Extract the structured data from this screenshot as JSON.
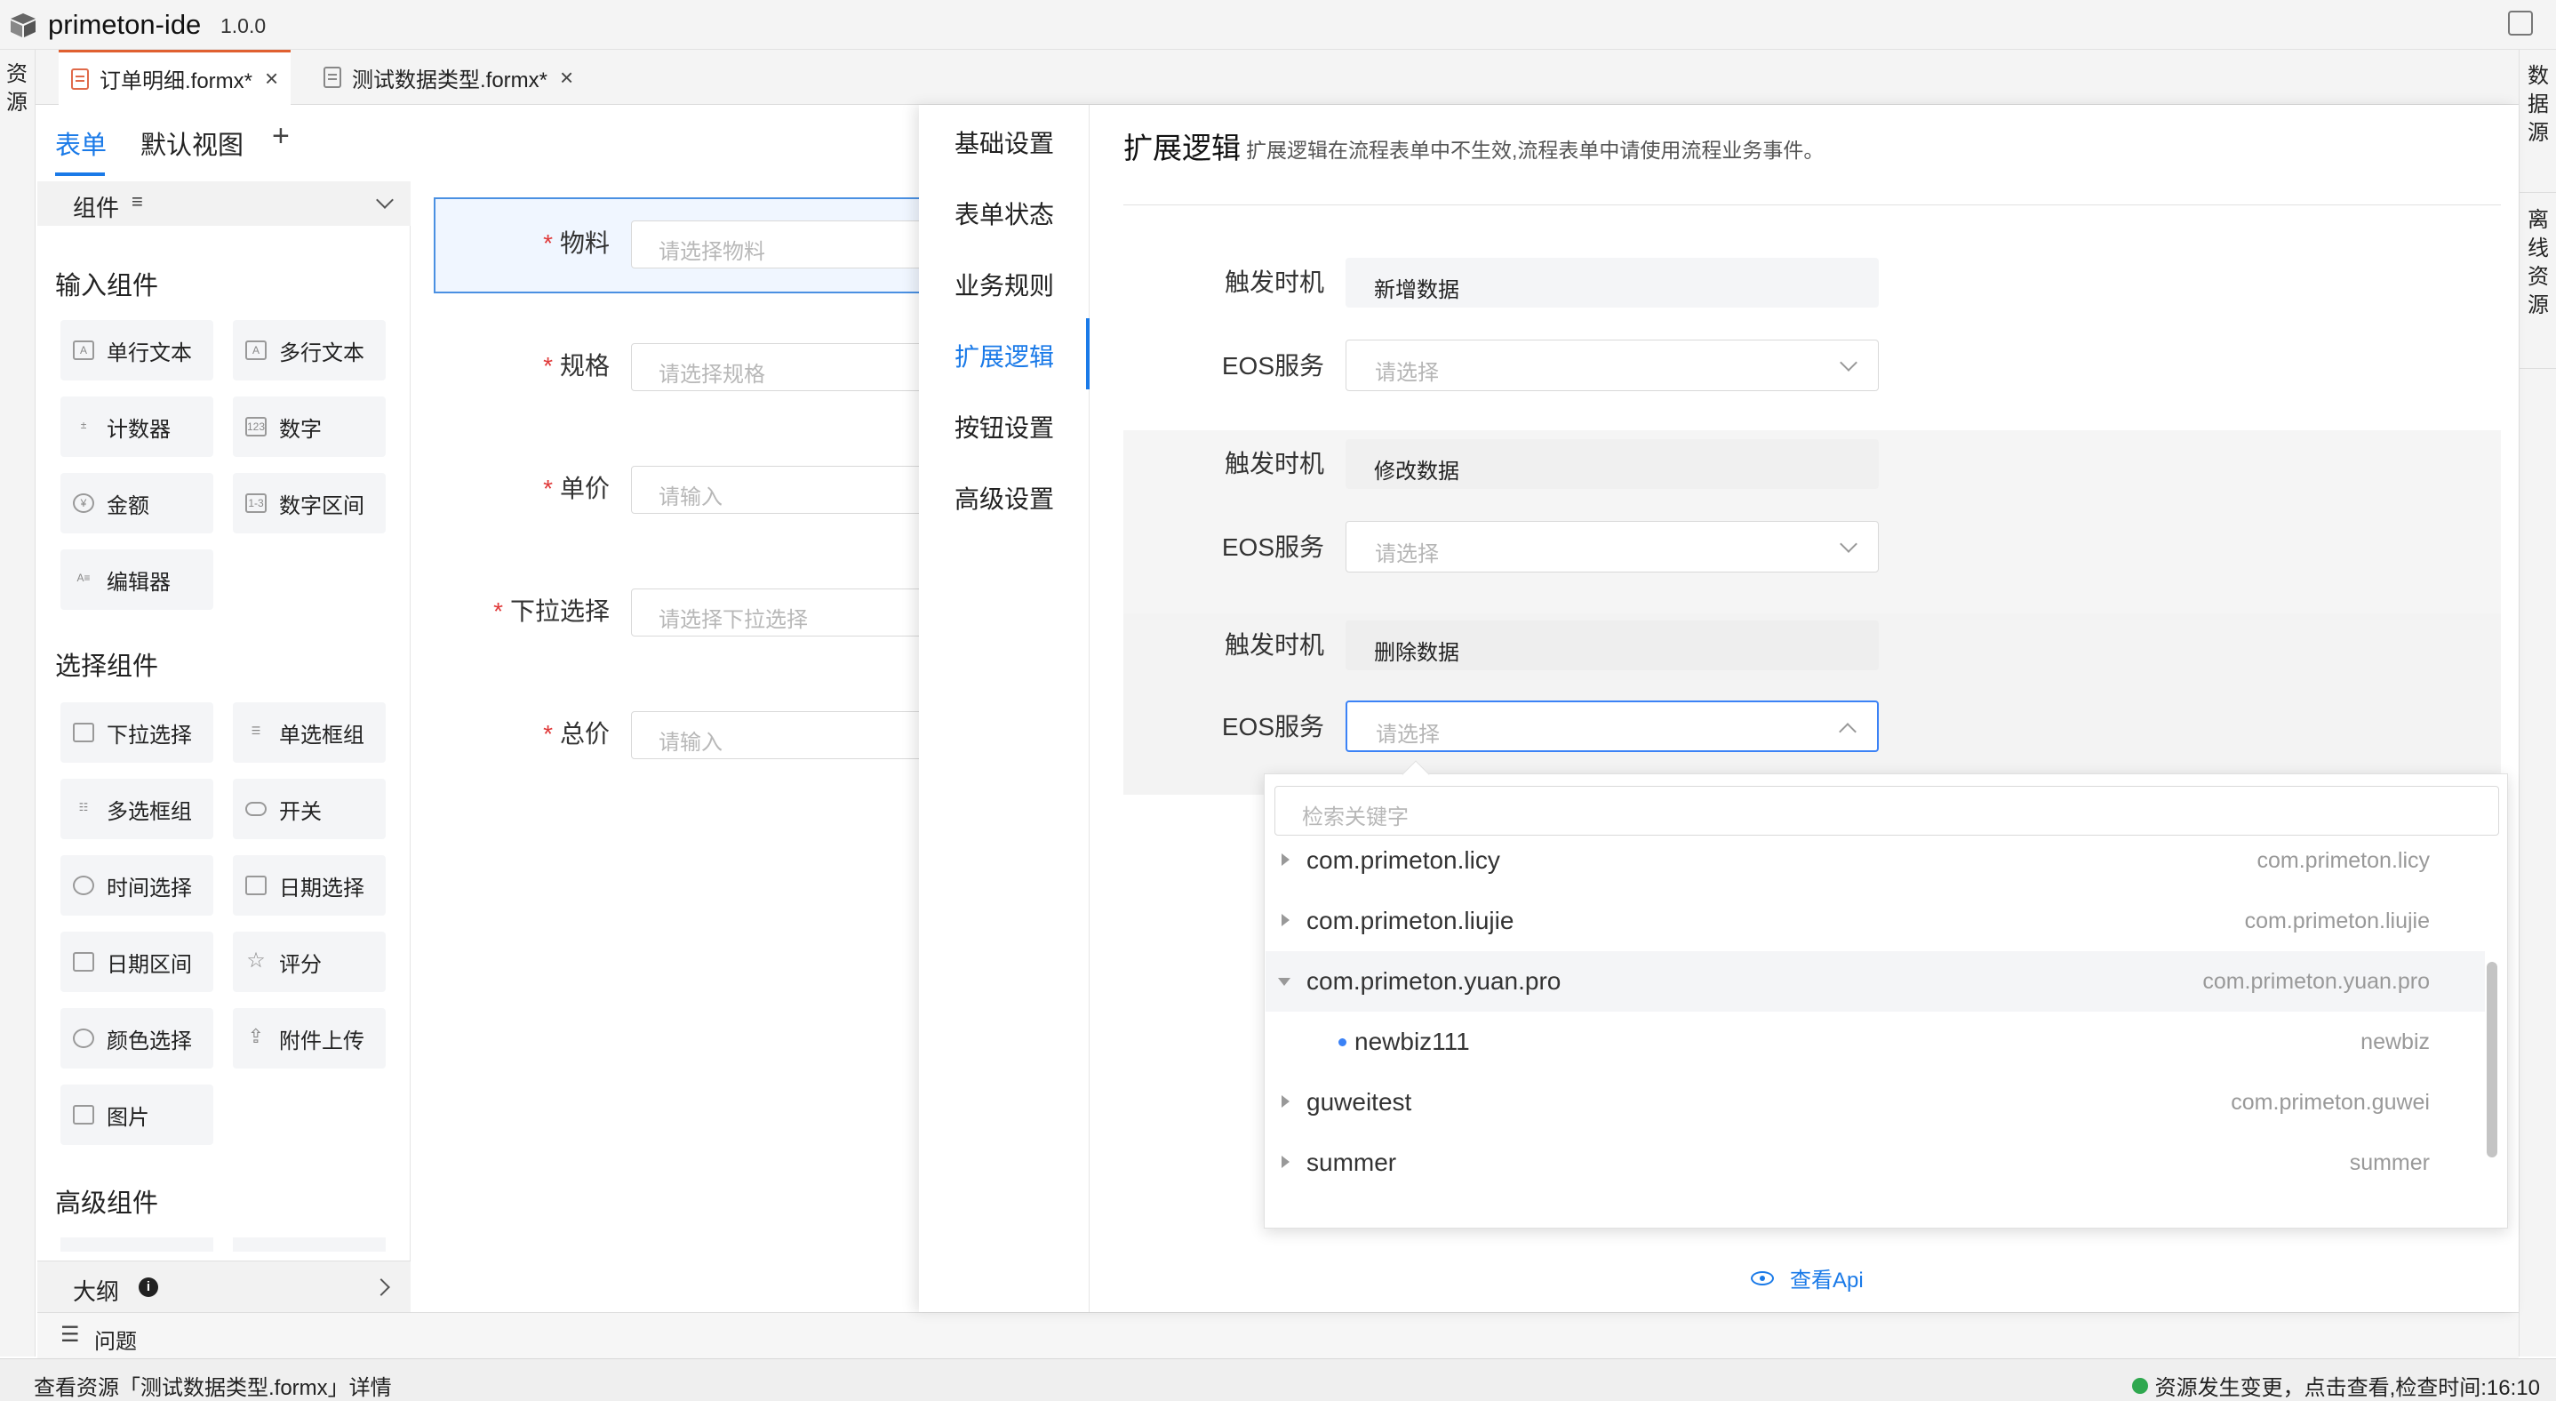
{
  "window": {
    "app_name": "primeton-ide",
    "version": "1.0.0"
  },
  "left_rail": {
    "label": "资源"
  },
  "right_rail": {
    "data_source": "数据源",
    "offline": "离线资源"
  },
  "file_tabs": [
    {
      "label": "订单明细.formx*",
      "active": true
    },
    {
      "label": "测试数据类型.formx*",
      "active": false
    }
  ],
  "editor_tabs": {
    "form": "表单",
    "default_view": "默认视图",
    "add": "+"
  },
  "palette": {
    "header": "组件",
    "input_group": "输入组件",
    "input_items": [
      "单行文本",
      "多行文本",
      "计数器",
      "数字",
      "金额",
      "数字区间",
      "编辑器"
    ],
    "select_group": "选择组件",
    "select_items": [
      "下拉选择",
      "单选框组",
      "多选框组",
      "开关",
      "时间选择",
      "日期选择",
      "日期区间",
      "评分",
      "颜色选择",
      "附件上传",
      "图片"
    ],
    "advanced_group": "高级组件",
    "outline": "大纲",
    "problems": "问题"
  },
  "form_fields": [
    {
      "label": "物料",
      "placeholder": "请选择物料"
    },
    {
      "label": "规格",
      "placeholder": "请选择规格"
    },
    {
      "label": "单价",
      "placeholder": "请输入"
    },
    {
      "label": "下拉选择",
      "placeholder": "请选择下拉选择"
    },
    {
      "label": "总价",
      "placeholder": "请输入"
    }
  ],
  "settings_nav": [
    "基础设置",
    "表单状态",
    "业务规则",
    "扩展逻辑",
    "按钮设置",
    "高级设置"
  ],
  "extension": {
    "title": "扩展逻辑",
    "desc": "扩展逻辑在流程表单中不生效,流程表单中请使用流程业务事件。",
    "trigger_label": "触发时机",
    "eos_label": "EOS服务",
    "select_placeholder": "请选择",
    "triggers": [
      "新增数据",
      "修改数据",
      "删除数据"
    ],
    "view_api": "查看Api"
  },
  "dropdown": {
    "search_placeholder": "检索关键字",
    "rows": [
      {
        "name": "com.primeton.licy",
        "value": "com.primeton.licy",
        "type": "collapsed"
      },
      {
        "name": "com.primeton.liujie",
        "value": "com.primeton.liujie",
        "type": "collapsed"
      },
      {
        "name": "com.primeton.yuan.pro",
        "value": "com.primeton.yuan.pro",
        "type": "expanded"
      },
      {
        "name": "newbiz111",
        "value": "newbiz",
        "type": "leaf"
      },
      {
        "name": "guweitest",
        "value": "com.primeton.guwei",
        "type": "collapsed"
      },
      {
        "name": "summer",
        "value": "summer",
        "type": "collapsed"
      }
    ]
  },
  "status": {
    "left": "查看资源「测试数据类型.formx」详情",
    "right": "资源发生变更，点击查看,检查时间:16:10",
    "dot_color": "#2fa84f"
  }
}
